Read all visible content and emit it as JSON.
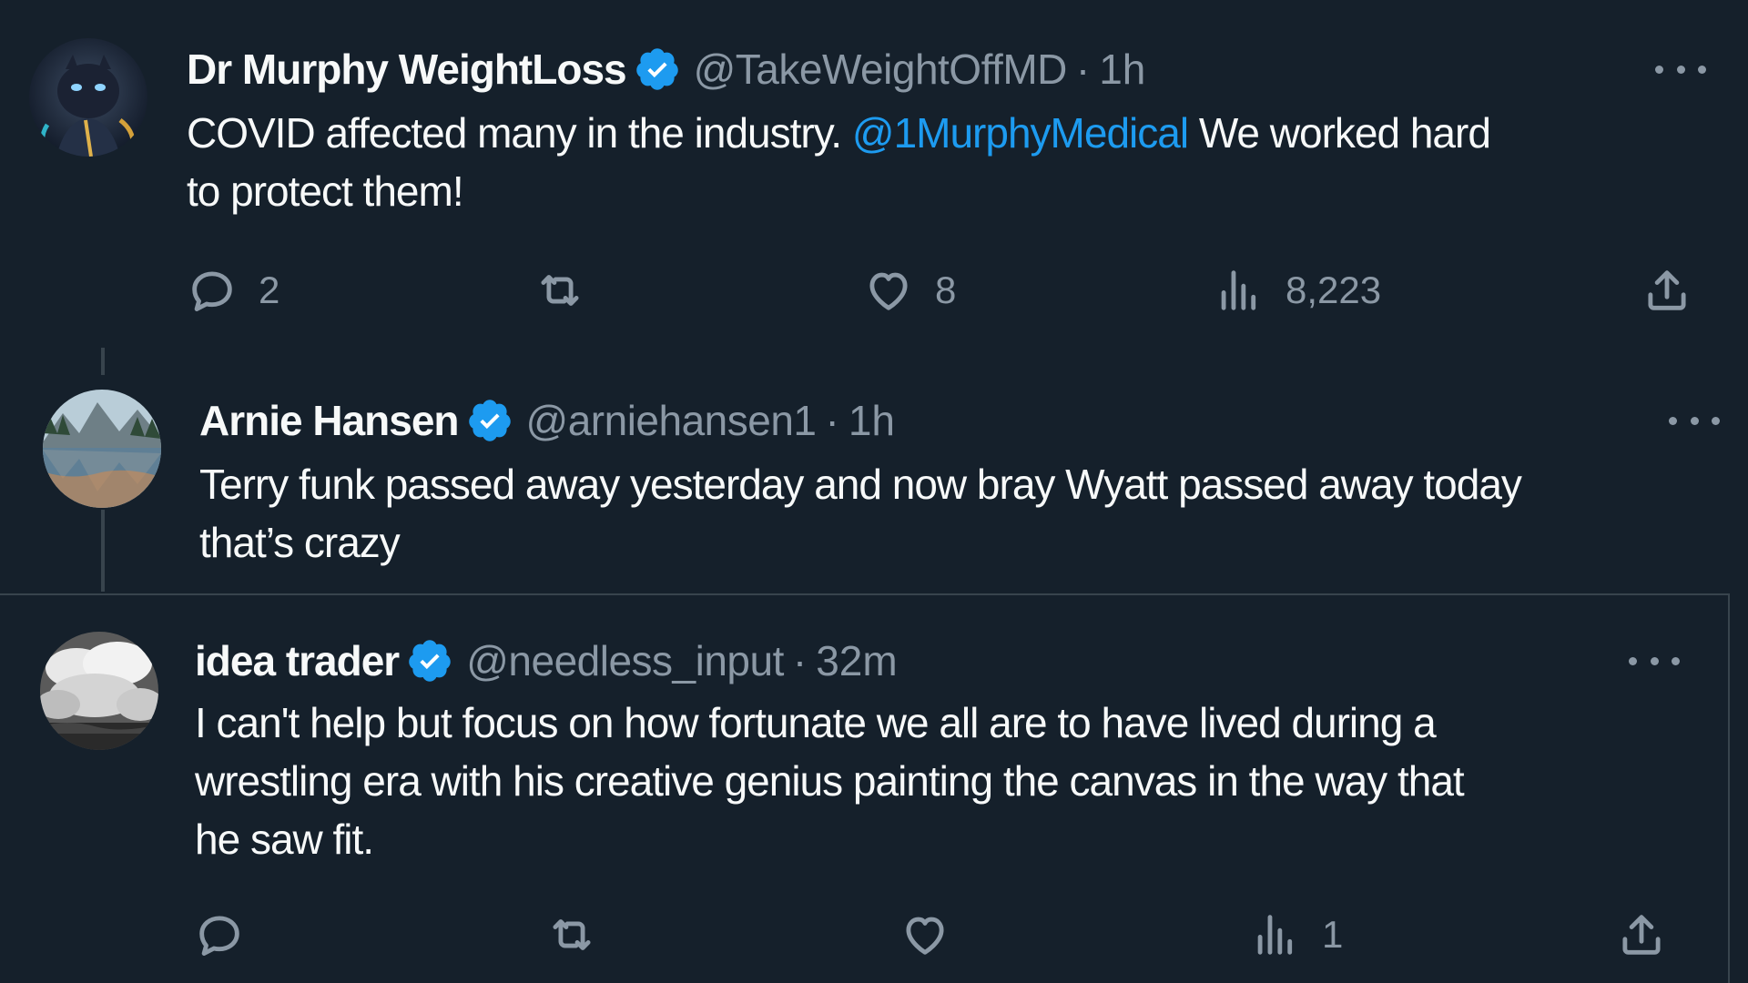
{
  "tweets": [
    {
      "name": "Dr Murphy WeightLoss",
      "handle": "@TakeWeightOffMD",
      "separator": "·",
      "time": "1h",
      "text_before": "COVID affected many in the industry. ",
      "mention": "@1MurphyMedical",
      "text_after_line1": " We worked hard",
      "text_line2": "to protect them!",
      "replies": "2",
      "retweets": "",
      "likes": "8",
      "views": "8,223"
    },
    {
      "name": "Arnie Hansen",
      "handle": "@arniehansen1",
      "separator": "·",
      "time": "1h",
      "text_line1": "Terry funk passed away yesterday and now bray Wyatt passed away today",
      "text_line2": "that’s crazy"
    },
    {
      "name": "idea trader",
      "handle": "@needless_input",
      "separator": "·",
      "time": "32m",
      "text_line1": "I can't help but focus on how fortunate we all are to have lived during a",
      "text_line2": "wrestling era with his creative genius painting the canvas in the way that",
      "text_line3": "he saw fit.",
      "replies": "",
      "retweets": "",
      "likes": "",
      "views": "1"
    }
  ],
  "icons": {
    "reply": "reply-icon",
    "retweet": "retweet-icon",
    "like": "heart-icon",
    "views": "views-icon",
    "share": "share-icon",
    "verified": "verified-badge-icon",
    "more": "more-options-icon"
  },
  "colors": {
    "background": "#15202b",
    "text": "#f7f9f9",
    "secondary": "#8b98a5",
    "accent": "#1d9bf0"
  }
}
